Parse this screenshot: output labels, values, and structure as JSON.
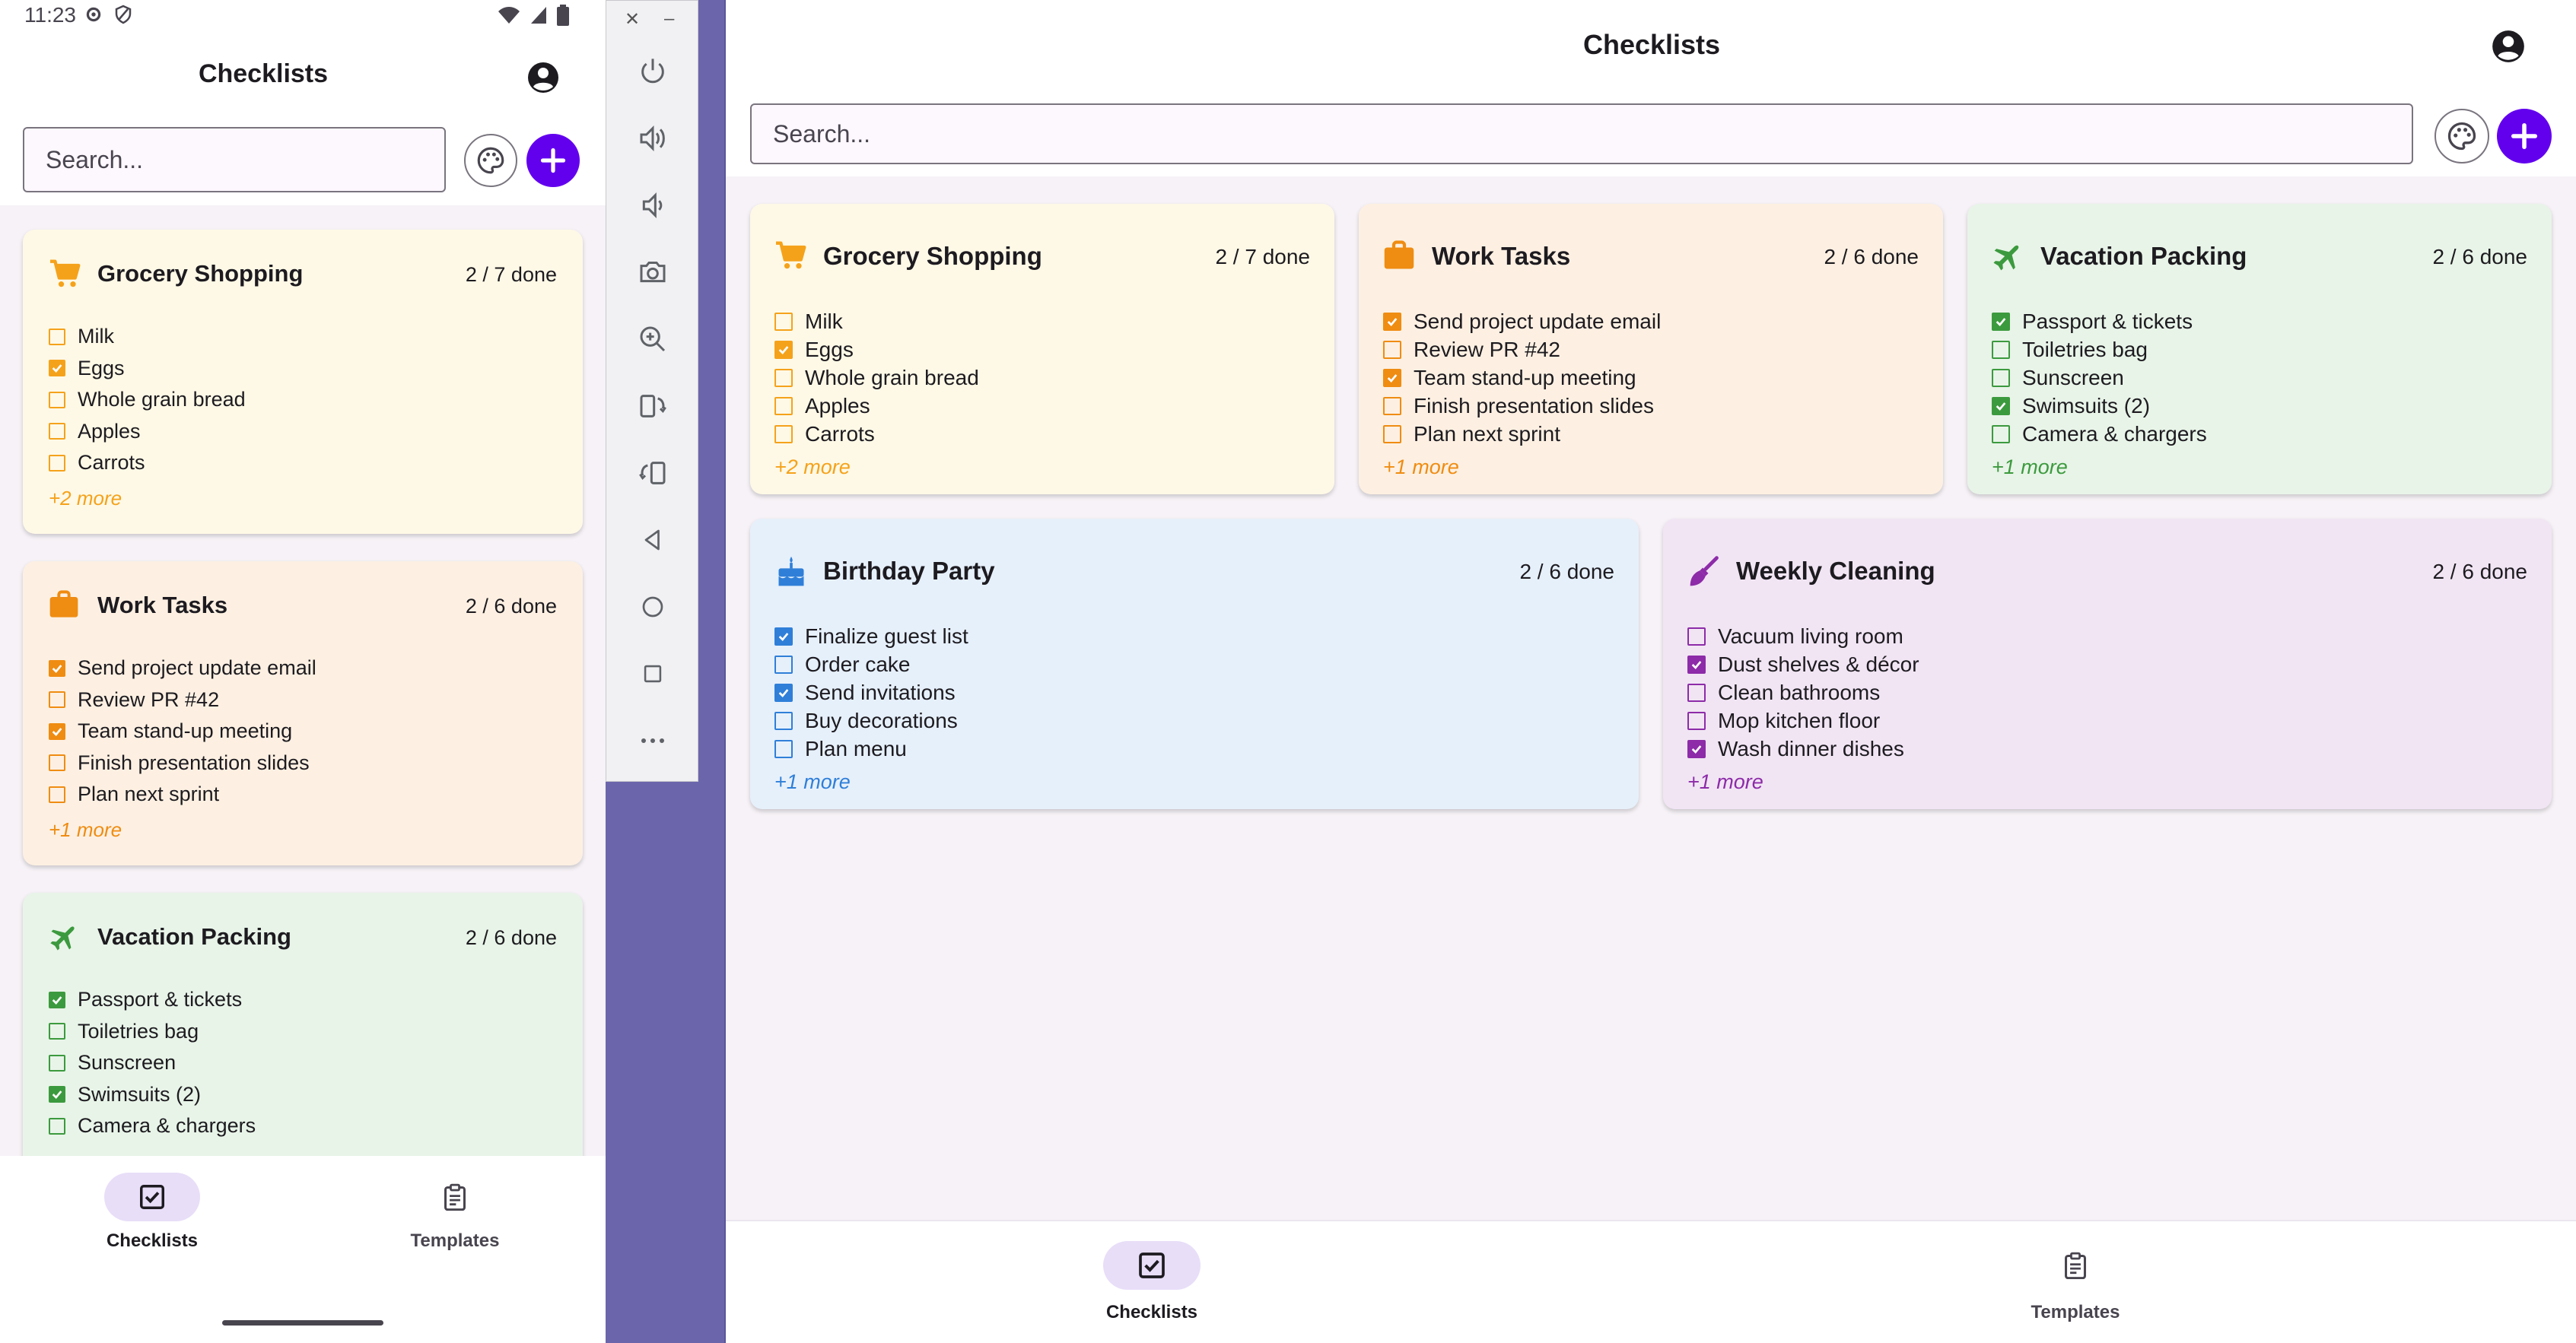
{
  "status_bar": {
    "time": "11:23"
  },
  "app": {
    "title": "Checklists"
  },
  "search": {
    "placeholder": "Search..."
  },
  "nav": {
    "checklists_label": "Checklists",
    "templates_label": "Templates"
  },
  "colors": {
    "accent": "#6200ee",
    "nav_pill": "#e8def8",
    "grocery_bg": "#fef9e6",
    "grocery_accent": "#f5a21b",
    "work_bg": "#fdf0e2",
    "work_accent": "#ef8c12",
    "vacation_bg": "#e8f4e8",
    "vacation_accent": "#3c9a3e",
    "birthday_bg": "#e6f0fb",
    "birthday_accent": "#2f7fd8",
    "cleaning_bg": "#f1e5f4",
    "cleaning_accent": "#8d2ba8"
  },
  "checklists": [
    {
      "title": "Grocery Shopping",
      "count": "2 / 7 done",
      "icon": "cart-icon",
      "more": "+2 more",
      "items": [
        {
          "label": "Milk",
          "checked": false
        },
        {
          "label": "Eggs",
          "checked": true
        },
        {
          "label": "Whole grain bread",
          "checked": false
        },
        {
          "label": "Apples",
          "checked": false
        },
        {
          "label": "Carrots",
          "checked": false
        }
      ]
    },
    {
      "title": "Work Tasks",
      "count": "2 / 6 done",
      "icon": "briefcase-icon",
      "more": "+1 more",
      "items": [
        {
          "label": "Send project update email",
          "checked": true
        },
        {
          "label": "Review PR #42",
          "checked": false
        },
        {
          "label": "Team stand-up meeting",
          "checked": true
        },
        {
          "label": "Finish presentation slides",
          "checked": false
        },
        {
          "label": "Plan next sprint",
          "checked": false
        }
      ]
    },
    {
      "title": "Vacation Packing",
      "count": "2 / 6 done",
      "icon": "airplane-icon",
      "more": "+1 more",
      "items": [
        {
          "label": "Passport & tickets",
          "checked": true
        },
        {
          "label": "Toiletries bag",
          "checked": false
        },
        {
          "label": "Sunscreen",
          "checked": false
        },
        {
          "label": "Swimsuits (2)",
          "checked": true
        },
        {
          "label": "Camera & chargers",
          "checked": false
        }
      ]
    },
    {
      "title": "Birthday Party",
      "count": "2 / 6 done",
      "icon": "cake-icon",
      "more": "+1 more",
      "items": [
        {
          "label": "Finalize guest list",
          "checked": true
        },
        {
          "label": "Order cake",
          "checked": false
        },
        {
          "label": "Send invitations",
          "checked": true
        },
        {
          "label": "Buy decorations",
          "checked": false
        },
        {
          "label": "Plan menu",
          "checked": false
        }
      ]
    },
    {
      "title": "Weekly Cleaning",
      "count": "2 / 6 done",
      "icon": "broom-icon",
      "more": "+1 more",
      "items": [
        {
          "label": "Vacuum living room",
          "checked": false
        },
        {
          "label": "Dust shelves & décor",
          "checked": true
        },
        {
          "label": "Clean bathrooms",
          "checked": false
        },
        {
          "label": "Mop kitchen floor",
          "checked": false
        },
        {
          "label": "Wash dinner dishes",
          "checked": true
        }
      ]
    }
  ]
}
